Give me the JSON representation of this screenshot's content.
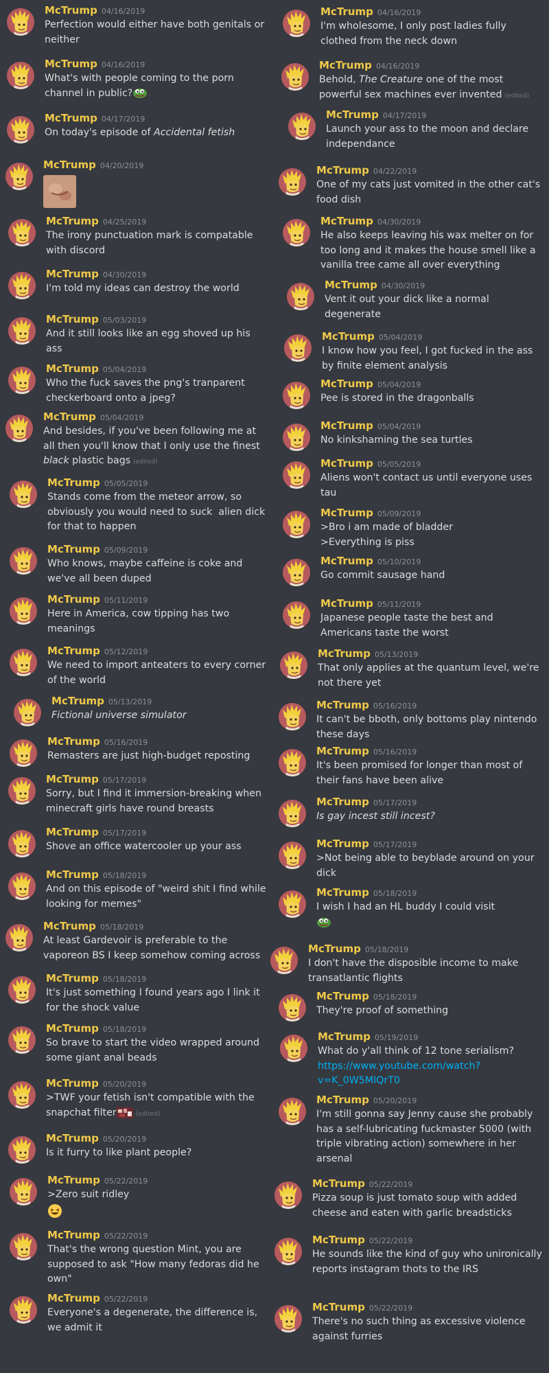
{
  "author": "McTrump",
  "edited_label": "(edited)",
  "left_messages": [
    {
      "time": "04/16/2019",
      "parts": [
        {
          "t": "Perfection would either have both genitals or neither"
        }
      ]
    },
    {
      "time": "04/16/2019",
      "parts": [
        {
          "t": "What's with people coming to the porn channel in public?"
        }
      ],
      "emoji": "pepe"
    },
    {
      "time": "04/17/2019",
      "parts": [
        {
          "t": "On today's episode of "
        },
        {
          "t": "Accidental fetish",
          "i": true
        }
      ]
    },
    {
      "time": "04/20/2019",
      "parts": [],
      "image": true
    },
    {
      "time": "04/25/2019",
      "parts": [
        {
          "t": "The irony punctuation mark is compatable with discord"
        }
      ]
    },
    {
      "time": "04/30/2019",
      "parts": [
        {
          "t": "I'm told my ideas can destroy the world"
        }
      ]
    },
    {
      "time": "05/03/2019",
      "parts": [
        {
          "t": "And it still looks like an egg shoved up his ass"
        }
      ]
    },
    {
      "time": "05/04/2019",
      "parts": [
        {
          "t": "Who the fuck saves the png's tranparent checkerboard onto a jpeg?"
        }
      ]
    },
    {
      "time": "05/04/2019",
      "parts": [
        {
          "t": "And besides, if you've been following me at all then you'll know that I only use the finest "
        },
        {
          "t": "black",
          "i": true
        },
        {
          "t": " plastic bags"
        }
      ],
      "edited": true
    },
    {
      "time": "05/05/2019",
      "parts": [
        {
          "t": "Stands come from the meteor arrow, so obviously you would need to suck  alien dick for that to happen"
        }
      ]
    },
    {
      "time": "05/09/2019",
      "parts": [
        {
          "t": "Who knows, maybe caffeine is coke and we've all been duped"
        }
      ]
    },
    {
      "time": "05/11/2019",
      "parts": [
        {
          "t": "Here in America, cow tipping has two meanings"
        }
      ]
    },
    {
      "time": "05/12/2019",
      "parts": [
        {
          "t": "We need to import anteaters to every corner of the world"
        }
      ]
    },
    {
      "time": "05/13/2019",
      "parts": [
        {
          "t": "Fictional universe simulator",
          "i": true
        }
      ]
    },
    {
      "time": "05/16/2019",
      "parts": [
        {
          "t": "Remasters are just high-budget reposting"
        }
      ]
    },
    {
      "time": "05/17/2019",
      "parts": [
        {
          "t": "Sorry, but I find it immersion-breaking when minecraft girls have round breasts"
        }
      ]
    },
    {
      "time": "05/17/2019",
      "parts": [
        {
          "t": "Shove an office watercooler up your ass"
        }
      ]
    },
    {
      "time": "05/18/2019",
      "parts": [
        {
          "t": "And on this episode of \"weird shit I find while looking for memes\""
        }
      ]
    },
    {
      "time": "05/18/2019",
      "parts": [
        {
          "t": "At least Gardevoir is preferable to the vaporeon BS I keep somehow coming across"
        }
      ]
    },
    {
      "time": "05/18/2019",
      "parts": [
        {
          "t": "It's just something I found years ago I link it for the shock value"
        }
      ]
    },
    {
      "time": "05/18/2019",
      "parts": [
        {
          "t": "So brave to start the video wrapped around some giant anal beads"
        }
      ]
    },
    {
      "time": "05/20/2019",
      "parts": [
        {
          "t": ">TWF your fetish isn't compatible with the snapchat filter"
        }
      ],
      "emoji": "pixel",
      "edited": true
    },
    {
      "time": "05/20/2019",
      "parts": [
        {
          "t": "Is it furry to like plant people?"
        }
      ]
    },
    {
      "time": "05/22/2019",
      "parts": [
        {
          "t": ">Zero suit ridley"
        }
      ],
      "emoji_line": "laugh"
    },
    {
      "time": "05/22/2019",
      "parts": [
        {
          "t": "That's the wrong question Mint, you are supposed to ask \"How many fedoras did he own\""
        }
      ]
    },
    {
      "time": "05/22/2019",
      "parts": [
        {
          "t": "Everyone's a degenerate, the difference is, we admit it"
        }
      ]
    }
  ],
  "right_messages": [
    {
      "time": "04/16/2019",
      "parts": [
        {
          "t": "I'm wholesome, I only post ladies fully clothed from the neck down"
        }
      ]
    },
    {
      "time": "04/16/2019",
      "parts": [
        {
          "t": "Behold, "
        },
        {
          "t": "The Creature",
          "i": true
        },
        {
          "t": " one of the most powerful sex machines ever invented"
        }
      ],
      "edited": true
    },
    {
      "time": "04/17/2019",
      "parts": [
        {
          "t": "Launch your ass to the moon and declare independance"
        }
      ]
    },
    {
      "time": "04/22/2019",
      "parts": [
        {
          "t": "One of my cats just vomited in the other cat's food dish"
        }
      ]
    },
    {
      "time": "04/30/2019",
      "parts": [
        {
          "t": "He also keeps leaving his wax melter on for too long and it makes the house smell like a vanilla tree came all over everything"
        }
      ]
    },
    {
      "time": "04/30/2019",
      "parts": [
        {
          "t": "Vent it out your dick like a normal degenerate"
        }
      ]
    },
    {
      "time": "05/04/2019",
      "parts": [
        {
          "t": "I know how you feel, I got fucked in the ass by finite element analysis"
        }
      ]
    },
    {
      "time": "05/04/2019",
      "parts": [
        {
          "t": "Pee is stored in the dragonballs"
        }
      ]
    },
    {
      "time": "05/04/2019",
      "parts": [
        {
          "t": "No kinkshaming the sea turtles"
        }
      ]
    },
    {
      "time": "05/05/2019",
      "parts": [
        {
          "t": "Aliens won't contact us until everyone uses tau"
        }
      ]
    },
    {
      "time": "05/09/2019",
      "parts": [
        {
          "t": ">Bro i am made of bladder\n>Everything is piss"
        }
      ]
    },
    {
      "time": "05/10/2019",
      "parts": [
        {
          "t": "Go commit sausage hand"
        }
      ]
    },
    {
      "time": "05/11/2019",
      "parts": [
        {
          "t": "Japanese people taste the best and Americans taste the worst"
        }
      ]
    },
    {
      "time": "05/13/2019",
      "parts": [
        {
          "t": "That only applies at the quantum level, we're not there yet"
        }
      ]
    },
    {
      "time": "05/16/2019",
      "parts": [
        {
          "t": "It can't be bboth, only bottoms play nintendo these days"
        }
      ]
    },
    {
      "time": "05/16/2019",
      "parts": [
        {
          "t": "It's been promised for longer than most of their fans have been alive"
        }
      ]
    },
    {
      "time": "05/17/2019",
      "parts": [
        {
          "t": "Is gay incest still incest?",
          "i": true
        }
      ]
    },
    {
      "time": "05/17/2019",
      "parts": [
        {
          "t": ">Not being able to beyblade around on your dick"
        }
      ]
    },
    {
      "time": "05/18/2019",
      "parts": [
        {
          "t": "I wish I had an HL buddy I could visit"
        }
      ],
      "emoji_line": "pepe"
    },
    {
      "time": "05/18/2019",
      "parts": [
        {
          "t": "I don't have the disposible income to make transatlantic flights"
        }
      ]
    },
    {
      "time": "05/18/2019",
      "parts": [
        {
          "t": "They're proof of something"
        }
      ]
    },
    {
      "time": "05/19/2019",
      "parts": [
        {
          "t": "What do y'all think of 12 tone serialism?\n"
        },
        {
          "t": "https://www.youtube.com/watch?v=K_0W5MIQrT0",
          "link": true
        }
      ]
    },
    {
      "time": "05/20/2019",
      "parts": [
        {
          "t": "I'm still gonna say Jenny cause she probably has a self-lubricating fuckmaster 5000 (with triple vibrating action) somewhere in her arsenal"
        }
      ]
    },
    {
      "time": "05/22/2019",
      "parts": [
        {
          "t": "Pizza soup is just tomato soup with added cheese and eaten with garlic breadsticks"
        }
      ]
    },
    {
      "time": "05/22/2019",
      "parts": [
        {
          "t": "He sounds like the kind of guy who unironically reports instagram thots to the IRS"
        }
      ]
    },
    {
      "time": "05/22/2019",
      "parts": [
        {
          "t": "There's no such thing as excessive violence against furries"
        }
      ]
    }
  ]
}
